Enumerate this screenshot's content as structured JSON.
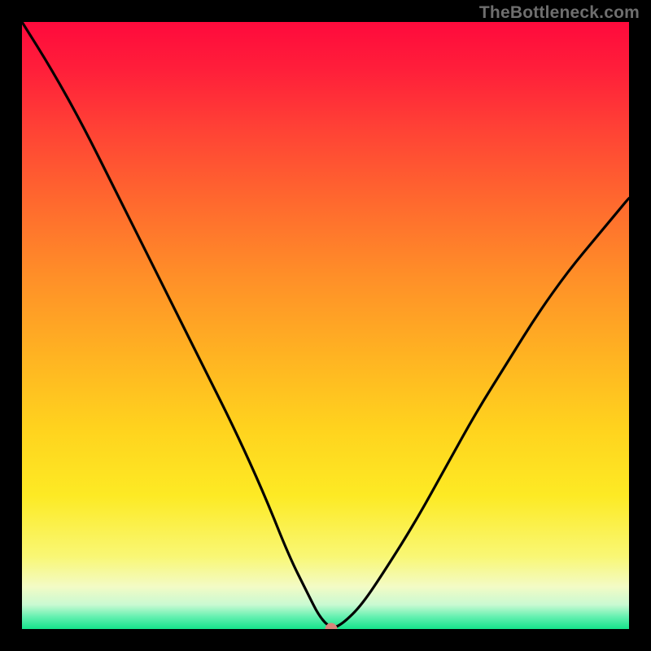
{
  "watermark": "TheBottleneck.com",
  "colors": {
    "frame": "#000000",
    "curve": "#000000",
    "marker": "#d9857b",
    "watermark": "#6e6e6e"
  },
  "chart_data": {
    "type": "line",
    "title": "",
    "xlabel": "",
    "ylabel": "",
    "xlim": [
      0,
      100
    ],
    "ylim": [
      0,
      100
    ],
    "grid": false,
    "legend": false,
    "background_gradient": {
      "orientation": "vertical",
      "stops": [
        {
          "pos": 0,
          "color": "#ff0a3c"
        },
        {
          "pos": 18,
          "color": "#ff4335"
        },
        {
          "pos": 42,
          "color": "#ff8f28"
        },
        {
          "pos": 67,
          "color": "#ffd31e"
        },
        {
          "pos": 88,
          "color": "#f9f774"
        },
        {
          "pos": 96,
          "color": "#c9fad2"
        },
        {
          "pos": 100,
          "color": "#15e38a"
        }
      ]
    },
    "series": [
      {
        "name": "bottleneck-curve",
        "x": [
          0,
          5,
          10,
          15,
          20,
          25,
          30,
          35,
          40,
          44,
          47,
          49,
          51,
          53,
          56,
          60,
          65,
          70,
          75,
          80,
          85,
          90,
          95,
          100
        ],
        "y": [
          100,
          92,
          83,
          73,
          63,
          53,
          43,
          33,
          22,
          12,
          6,
          2,
          0,
          1,
          4,
          10,
          18,
          27,
          36,
          44,
          52,
          59,
          65,
          71
        ]
      }
    ],
    "marker": {
      "x": 51,
      "y": 0
    }
  }
}
